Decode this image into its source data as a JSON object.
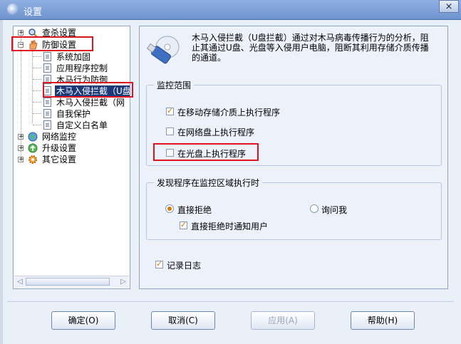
{
  "window": {
    "title": "设置",
    "close_glyph": "×"
  },
  "tree": {
    "items": [
      {
        "label": "查杀设置",
        "expander": "+"
      },
      {
        "label": "防御设置",
        "expander": "−"
      },
      {
        "label": "系统加固"
      },
      {
        "label": "应用程序控制"
      },
      {
        "label": "木马行为防御"
      },
      {
        "label": "木马入侵拦截（U盘"
      },
      {
        "label": "木马入侵拦截（网"
      },
      {
        "label": "自我保护"
      },
      {
        "label": "自定义白名单"
      },
      {
        "label": "网络监控",
        "expander": "+"
      },
      {
        "label": "升级设置",
        "expander": "+"
      },
      {
        "label": "其它设置",
        "expander": "+"
      }
    ],
    "scroll_left": "◁",
    "scroll_right": "▷"
  },
  "description": "木马入侵拦截（U盘拦截）通过对木马病毒传播行为的分析，阻止其通过U盘、光盘等入侵用户电脑，阻断其利用存储介质传播的通道。",
  "monitor_scope": {
    "legend": "监控范围",
    "options": [
      {
        "label": "在移动存储介质上执行程序",
        "checked": true
      },
      {
        "label": "在网络盘上执行程序",
        "checked": false
      },
      {
        "label": "在光盘上执行程序",
        "checked": false
      }
    ]
  },
  "on_detect": {
    "legend": "发现程序在监控区域执行时",
    "radio_block": "直接拒绝",
    "radio_ask": "询问我",
    "notify_label": "直接拒绝时通知用户",
    "selected": "直接拒绝",
    "notify_checked": true
  },
  "log": {
    "label": "记录日志",
    "checked": true
  },
  "buttons": {
    "ok": "确定(O)",
    "cancel": "取消(C)",
    "apply": "应用(A)",
    "help": "帮助(H)"
  },
  "colors": {
    "highlight_box": "#e0141e",
    "selection": "#1c3a7a",
    "check": "#d77a00"
  }
}
